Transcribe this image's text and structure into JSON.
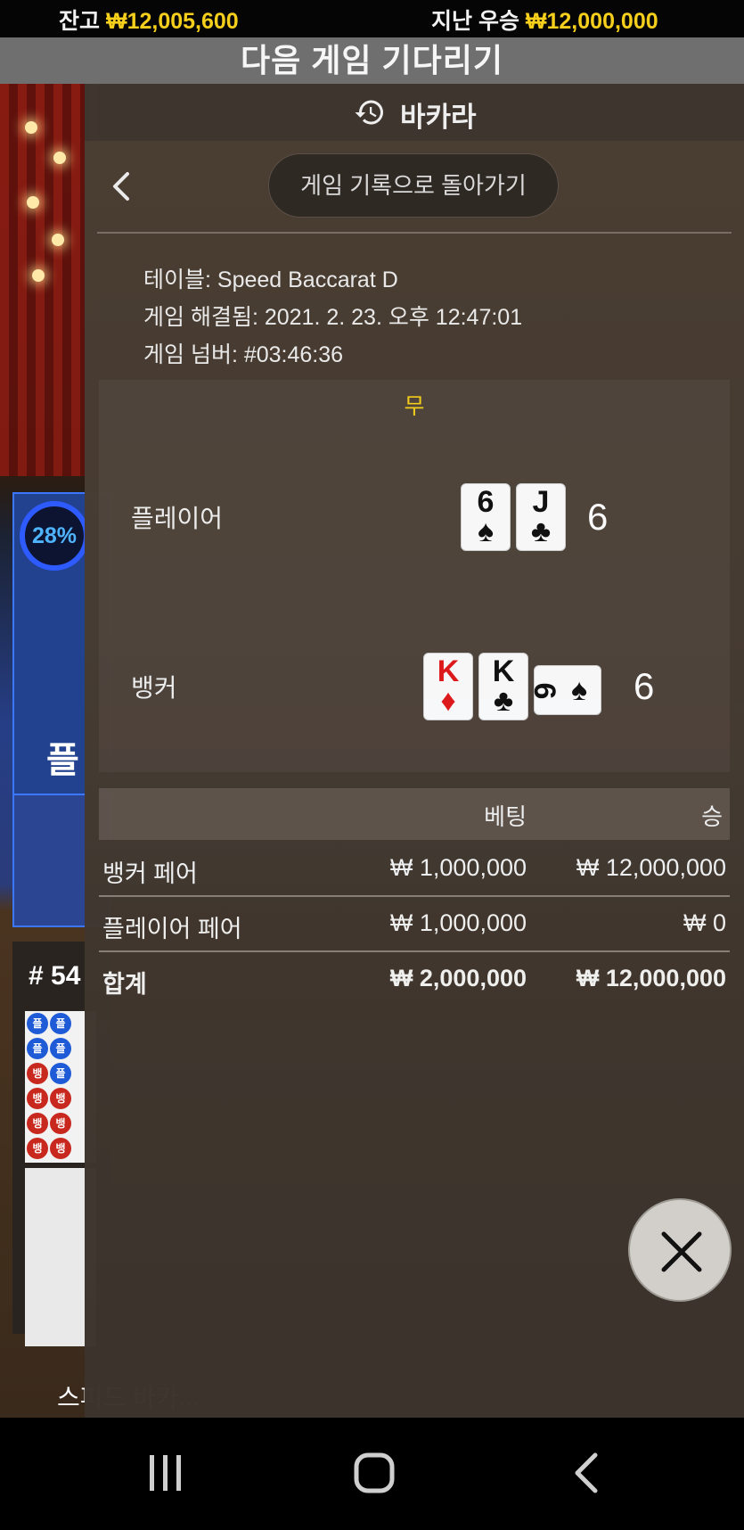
{
  "topbar": {
    "balance_label": "잔고",
    "balance_value": "₩12,005,600",
    "lastwin_label": "지난 우승",
    "lastwin_value": "₩12,000,000"
  },
  "waiting_banner": "다음 게임 기다리기",
  "background": {
    "round_percent": "28%",
    "player_short": "플",
    "road_title": "# 54",
    "footer_text": "스피드 바카..."
  },
  "panel": {
    "title": "바카라",
    "back_button": "게임 기록으로 돌아가기",
    "info": {
      "table": "테이블: Speed Baccarat D",
      "resolved": "게임 해결됨: 2021. 2. 23. 오후 12:47:01",
      "game_number": "게임 넘버: #03:46:36"
    },
    "result": {
      "outcome": "무",
      "player": {
        "label": "플레이어",
        "score": "6",
        "cards": [
          {
            "rank": "6",
            "suit": "♠",
            "color": "black"
          },
          {
            "rank": "J",
            "suit": "♣",
            "color": "black"
          }
        ]
      },
      "banker": {
        "label": "뱅커",
        "score": "6",
        "cards": [
          {
            "rank": "K",
            "suit": "♦",
            "color": "red"
          },
          {
            "rank": "K",
            "suit": "♣",
            "color": "black"
          },
          {
            "rank": "6",
            "suit": "♠",
            "color": "black",
            "sideways": true
          }
        ]
      }
    },
    "bets": {
      "headers": {
        "bet": "베팅",
        "win": "승"
      },
      "rows": [
        {
          "name": "뱅커 페어",
          "bet": "₩ 1,000,000",
          "win": "₩ 12,000,000"
        },
        {
          "name": "플레이어 페어",
          "bet": "₩ 1,000,000",
          "win": "₩ 0"
        },
        {
          "name": "합계",
          "bet": "₩ 2,000,000",
          "win": "₩ 12,000,000"
        }
      ]
    }
  },
  "colors": {
    "accent_gold": "#f5cf1b",
    "panel_bg": "#473c32",
    "close_button_bg": "#d2cfca"
  }
}
